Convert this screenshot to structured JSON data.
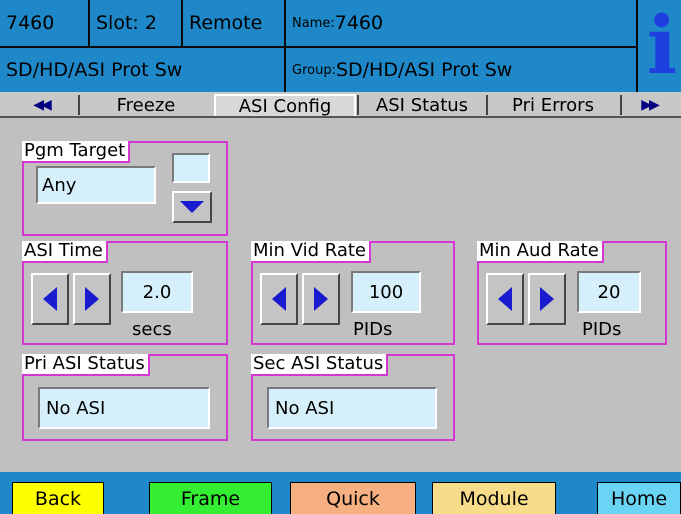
{
  "header": {
    "device": "7460",
    "slot_label": "Slot: 2",
    "mode": "Remote",
    "name_label": "Name:",
    "name_value": "7460",
    "product": "SD/HD/ASI Prot Sw",
    "group_label": "Group:",
    "group_value": "SD/HD/ASI Prot Sw",
    "info_glyph": "i"
  },
  "tabs": {
    "prev_icon": "◀◀",
    "next_icon": "▶▶",
    "items": [
      "Freeze",
      "ASI Config",
      "ASI Status",
      "Pri Errors"
    ],
    "active": "ASI Config"
  },
  "pgm_target": {
    "label": "Pgm Target",
    "value": "Any"
  },
  "asi_time": {
    "label": "ASI Time",
    "value": "2.0",
    "unit": "secs"
  },
  "min_vid_rate": {
    "label": "Min Vid Rate",
    "value": "100",
    "unit": "PIDs"
  },
  "min_aud_rate": {
    "label": "Min Aud Rate",
    "value": "20",
    "unit": "PIDs"
  },
  "pri_asi_status": {
    "label": "Pri ASI Status",
    "value": "No ASI"
  },
  "sec_asi_status": {
    "label": "Sec ASI Status",
    "value": "No ASI"
  },
  "footer": {
    "back": "Back",
    "frame": "Frame",
    "quick": "Quick",
    "module": "Module",
    "home": "Home"
  },
  "colors": {
    "header_bg": "#1e88c9",
    "group_border": "#d338d3",
    "field_bg": "#d6f0fb",
    "back": "#ffff00",
    "frame": "#33ee33",
    "quick": "#f6b082",
    "module": "#f7dc8a",
    "home": "#6ad4f4",
    "info": "#1f3fe0",
    "arrow": "#1a1ad0"
  },
  "icons": {
    "left_arrow": "left-arrow-icon",
    "right_arrow": "right-arrow-icon",
    "dropdown": "dropdown-arrow-icon",
    "info": "info-icon"
  }
}
